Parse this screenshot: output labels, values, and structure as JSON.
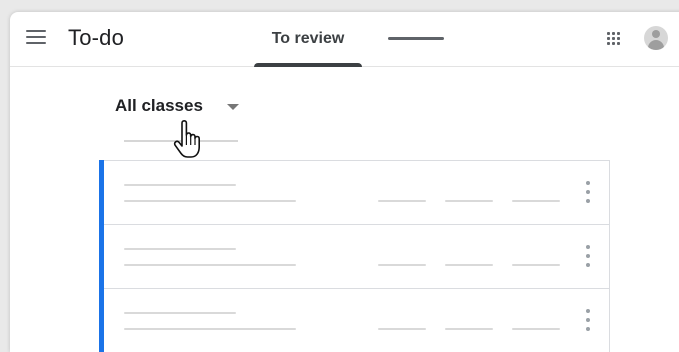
{
  "header": {
    "title": "To-do",
    "tabs": [
      {
        "label": "To review",
        "active": true
      },
      {
        "label": "",
        "active": false
      }
    ]
  },
  "filter": {
    "selected": "All classes"
  },
  "list": {
    "items": [
      {
        "id": 1
      },
      {
        "id": 2
      },
      {
        "id": 3
      }
    ]
  },
  "colors": {
    "accent": "#1a73e8",
    "title_text": "#202124",
    "tab_indicator": "#3c4043",
    "placeholder_line": "#d9d9d9"
  },
  "icons": {
    "menu": "hamburger-menu-icon",
    "apps": "apps-grid-icon",
    "avatar": "account-avatar-icon",
    "dropdown": "caret-down-icon",
    "more": "more-vert-icon",
    "cursor": "hand-pointer-cursor"
  }
}
